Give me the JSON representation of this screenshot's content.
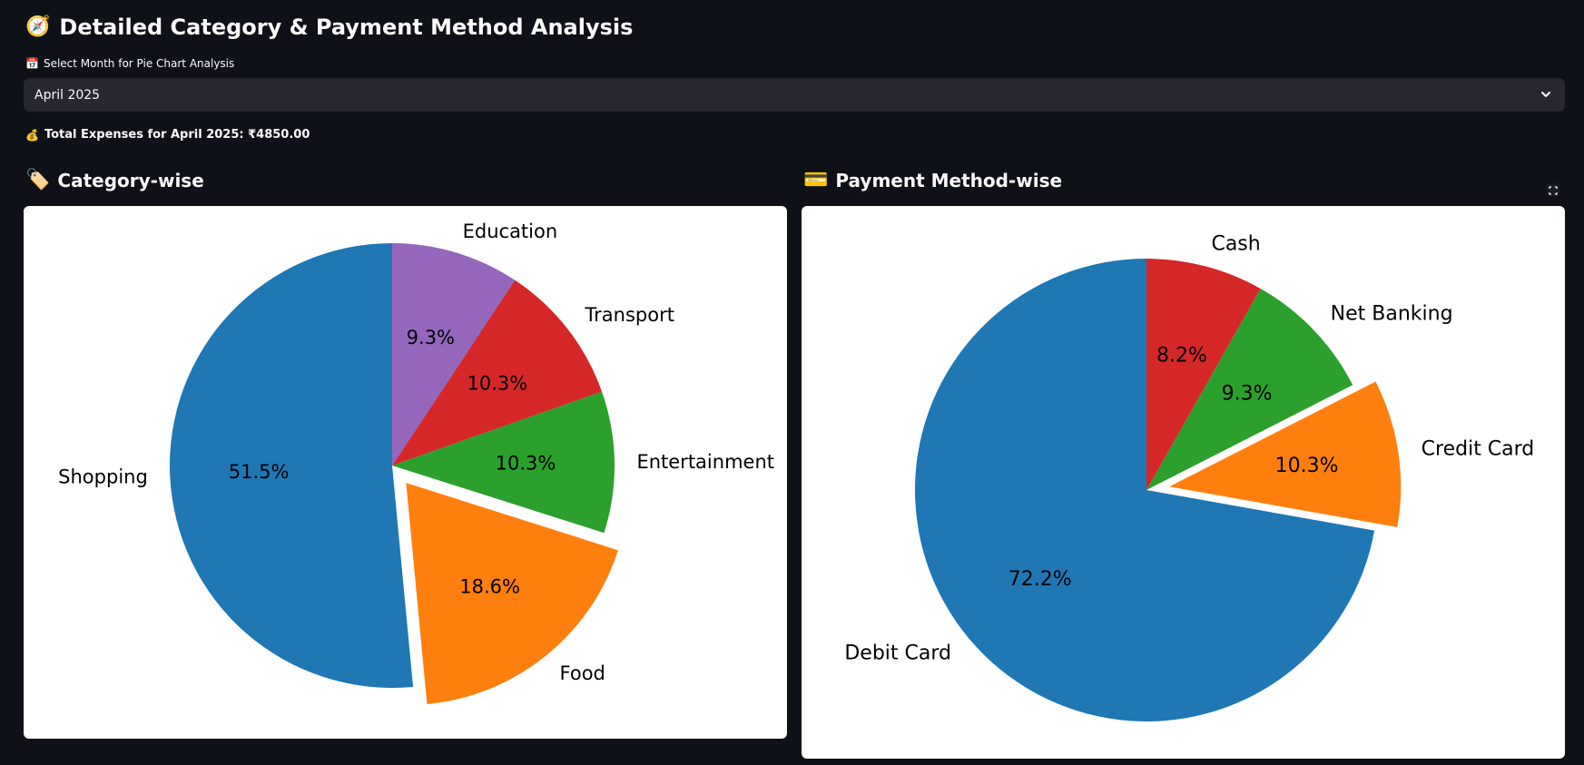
{
  "header": {
    "title_icon": "compass-icon",
    "title": "Detailed Category & Payment Method Analysis"
  },
  "month_select": {
    "label_icon": "calendar-icon",
    "label": "Select Month for Pie Chart Analysis",
    "selected": "April 2025"
  },
  "summary": {
    "icon": "money-bag-icon",
    "total_text": "Total Expenses for April 2025: ₹4850.00"
  },
  "sections": {
    "category_icon": "tag-icon",
    "category_title": "Category-wise",
    "payment_icon": "credit-card-icon",
    "payment_title": "Payment Method-wise"
  },
  "chart_data": [
    {
      "type": "pie",
      "title": "Category-wise",
      "start_angle_deg": 90,
      "direction": "counterclockwise",
      "slices": [
        {
          "label": "Shopping",
          "value": 51.5,
          "pct_text": "51.5%",
          "color": "#1f77b4",
          "explode": 0
        },
        {
          "label": "Food",
          "value": 18.6,
          "pct_text": "18.6%",
          "color": "#ff7f0e",
          "explode": 0.1
        },
        {
          "label": "Entertainment",
          "value": 10.3,
          "pct_text": "10.3%",
          "color": "#2ca02c",
          "explode": 0
        },
        {
          "label": "Transport",
          "value": 10.3,
          "pct_text": "10.3%",
          "color": "#d62728",
          "explode": 0
        },
        {
          "label": "Education",
          "value": 9.3,
          "pct_text": "9.3%",
          "color": "#9467bd",
          "explode": 0
        }
      ]
    },
    {
      "type": "pie",
      "title": "Payment Method-wise",
      "start_angle_deg": 90,
      "direction": "counterclockwise",
      "slices": [
        {
          "label": "Debit Card",
          "value": 72.2,
          "pct_text": "72.2%",
          "color": "#1f77b4",
          "explode": 0
        },
        {
          "label": "Credit Card",
          "value": 10.3,
          "pct_text": "10.3%",
          "color": "#ff7f0e",
          "explode": 0.1
        },
        {
          "label": "Net Banking",
          "value": 9.3,
          "pct_text": "9.3%",
          "color": "#2ca02c",
          "explode": 0
        },
        {
          "label": "Cash",
          "value": 8.2,
          "pct_text": "8.2%",
          "color": "#d62728",
          "explode": 0
        }
      ]
    }
  ]
}
